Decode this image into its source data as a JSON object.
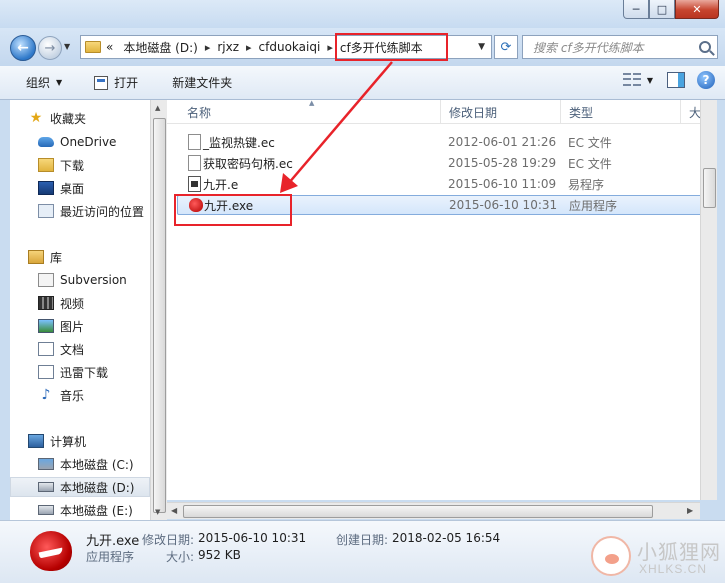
{
  "window": {
    "minimize": "─",
    "maximize": "□",
    "close": "✕"
  },
  "address": {
    "chevron": "«",
    "crumbs": [
      "本地磁盘 (D:)",
      "rjxz",
      "cfduokaiqi",
      "cf多开代练脚本"
    ],
    "separator": "▸",
    "search_placeholder": "搜索 cf多开代练脚本"
  },
  "toolbar": {
    "organize": "组织",
    "open": "打开",
    "new_folder": "新建文件夹"
  },
  "nav": {
    "favorites": "收藏夹",
    "onedrive": "OneDrive",
    "downloads": "下载",
    "desktop": "桌面",
    "recent": "最近访问的位置",
    "libraries": "库",
    "subversion": "Subversion",
    "videos": "视频",
    "pictures": "图片",
    "documents": "文档",
    "xunlei": "迅雷下载",
    "music": "音乐",
    "computer": "计算机",
    "drive_c": "本地磁盘 (C:)",
    "drive_d": "本地磁盘 (D:)",
    "drive_e": "本地磁盘 (E:)"
  },
  "columns": {
    "name": "名称",
    "date": "修改日期",
    "type": "类型",
    "size": "大小"
  },
  "files": [
    {
      "name": "_监视热键.ec",
      "date": "2012-06-01 21:26",
      "type": "EC 文件",
      "icon": "ec-file-icon"
    },
    {
      "name": "获取密码句柄.ec",
      "date": "2015-05-28 19:29",
      "type": "EC 文件",
      "icon": "ec-file-icon"
    },
    {
      "name": "九开.e",
      "date": "2015-06-10 11:09",
      "type": "易程序",
      "icon": "e-file-icon"
    },
    {
      "name": "九开.exe",
      "date": "2015-06-10 10:31",
      "type": "应用程序",
      "icon": "exe-app-icon"
    }
  ],
  "details": {
    "name": "九开.exe",
    "type": "应用程序",
    "modified_label": "修改日期:",
    "modified": "2015-06-10 10:31",
    "created_label": "创建日期:",
    "created": "2018-02-05 16:54",
    "size_label": "大小:",
    "size": "952 KB"
  },
  "watermark": {
    "title": "小狐狸网",
    "url": "XHLKS.CN"
  },
  "colors": {
    "annotation": "#e8232a",
    "selection": "#d4e6fb"
  }
}
